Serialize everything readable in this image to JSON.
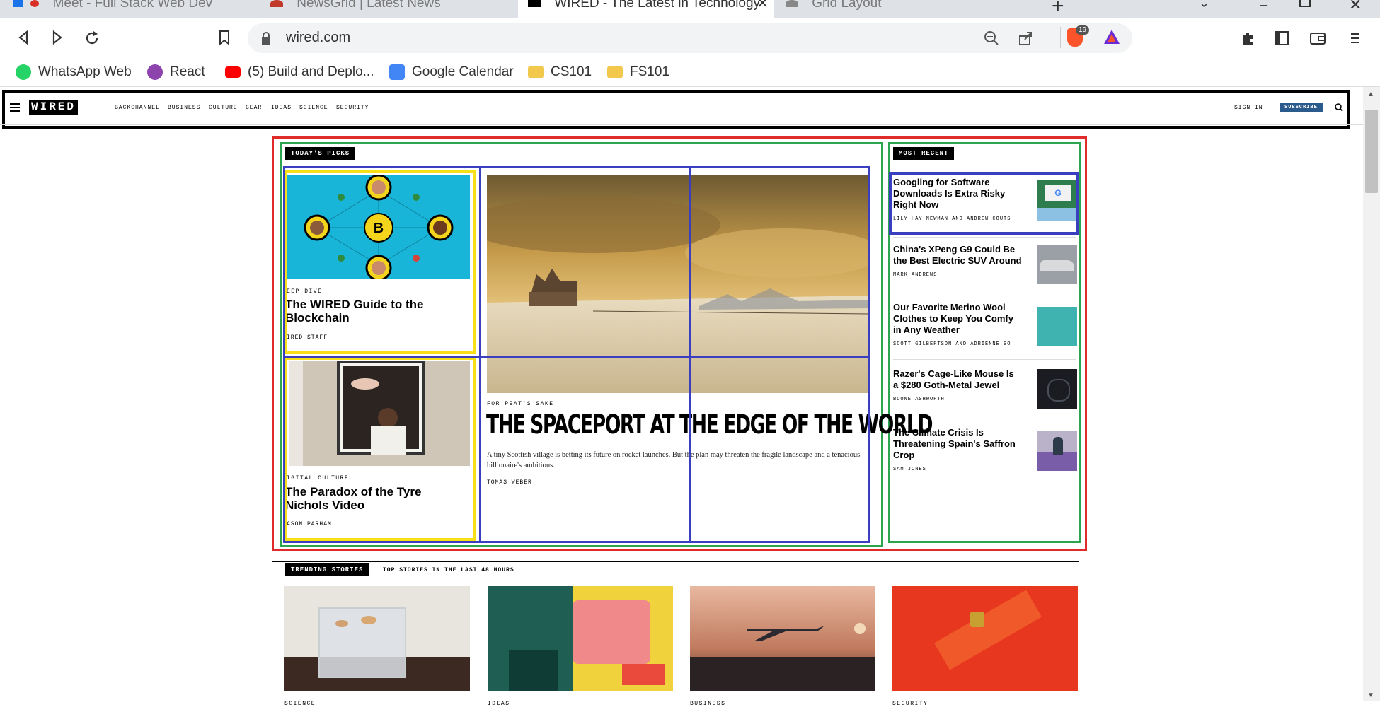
{
  "browser": {
    "tabs": [
      {
        "title": "Meet - Full Stack Web Dev",
        "active": false
      },
      {
        "title": "NewsGrid | Latest News",
        "active": false
      },
      {
        "title": "WIRED - The Latest in Technology",
        "active": true
      },
      {
        "title": "Grid Layout",
        "active": false
      }
    ],
    "url": "wired.com",
    "extension_badge": "19",
    "bookmarks": [
      {
        "label": "WhatsApp Web",
        "icon": "whatsapp-icon",
        "color": "#25d366"
      },
      {
        "label": "React",
        "icon": "react-icon",
        "color": "#8e44ad"
      },
      {
        "label": "(5) Build and Deplo...",
        "icon": "youtube-icon",
        "color": "#ff0000"
      },
      {
        "label": "Google Calendar",
        "icon": "calendar-icon",
        "color": "#4285f4"
      },
      {
        "label": "CS101",
        "icon": "folder-icon",
        "color": "#f2c94c"
      },
      {
        "label": "FS101",
        "icon": "folder-icon",
        "color": "#f2c94c"
      }
    ]
  },
  "site": {
    "logo": "WIRED",
    "nav": [
      "BACKCHANNEL",
      "BUSINESS",
      "CULTURE",
      "GEAR",
      "IDEAS",
      "SCIENCE",
      "SECURITY"
    ],
    "sign_in": "SIGN IN",
    "subscribe": "SUBSCRIBE",
    "subscribe_color": "#2b5a8c"
  },
  "todays_picks": {
    "label": "TODAY'S PICKS",
    "card1": {
      "kicker": "EEP DIVE",
      "title": "The WIRED Guide to the Blockchain",
      "byline": "IRED STAFF"
    },
    "card2": {
      "kicker": "IGITAL CULTURE",
      "title": "The Paradox of the Tyre Nichols Video",
      "byline": "ASON PARHAM"
    },
    "hero": {
      "kicker": "FOR PEAT'S SAKE",
      "title": "THE SPACEPORT AT THE EDGE OF THE WORLD",
      "dek": "A tiny Scottish village is betting its future on rocket launches. But the plan may threaten the fragile landscape and a tenacious billionaire's ambitions.",
      "byline": "TOMAS WEBER"
    }
  },
  "most_recent": {
    "label": "MOST RECENT",
    "items": [
      {
        "title": "Googling for Software Downloads Is Extra Risky Right Now",
        "byline": "LILY HAY NEWMAN AND ANDREW COUTS"
      },
      {
        "title": "China's XPeng G9 Could Be the Best Electric SUV Around",
        "byline": "MARK ANDREWS"
      },
      {
        "title": "Our Favorite Merino Wool Clothes to Keep You Comfy in Any Weather",
        "byline": "SCOTT GILBERTSON AND ADRIENNE SO"
      },
      {
        "title": "Razer's Cage-Like Mouse Is a $280 Goth-Metal Jewel",
        "byline": "BOONE ASHWORTH"
      },
      {
        "title": "The Climate Crisis Is Threatening Spain's Saffron Crop",
        "byline": "SAM JONES"
      }
    ]
  },
  "trending": {
    "label": "TRENDING STORIES",
    "sublabel": "TOP STORIES IN THE LAST 48 HOURS",
    "cards": [
      {
        "kicker": "SCIENCE"
      },
      {
        "kicker": "IDEAS"
      },
      {
        "kicker": "BUSINESS"
      },
      {
        "kicker": "SECURITY"
      }
    ]
  }
}
